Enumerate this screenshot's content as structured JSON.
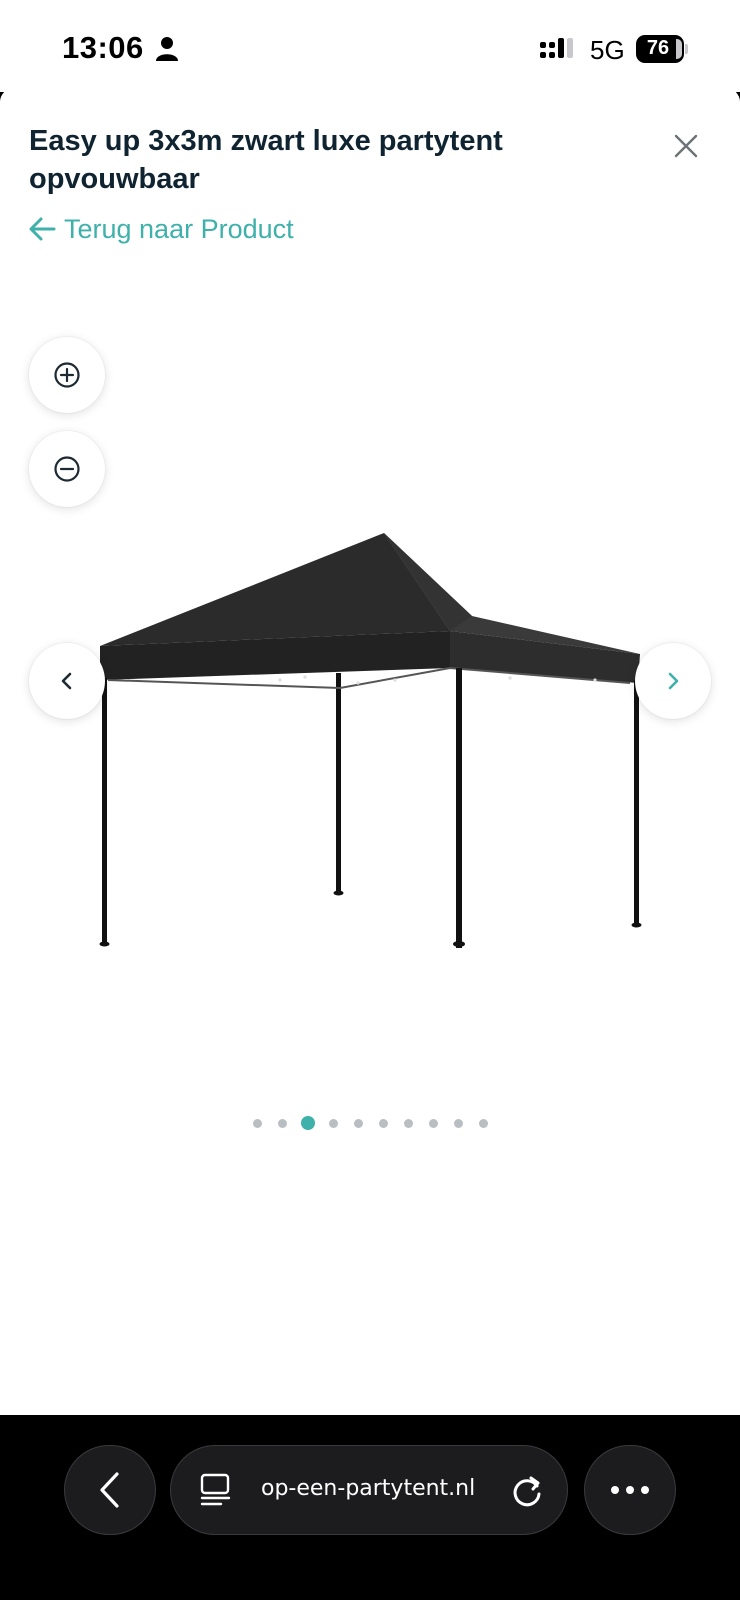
{
  "status_bar": {
    "time": "13:06",
    "network": "5G",
    "battery": "76",
    "icons": [
      "person-icon",
      "signal-icon",
      "battery-icon"
    ]
  },
  "modal": {
    "title": "Easy up 3x3m zwart luxe partytent opvouwbaar",
    "back_link": "Terug naar Product",
    "accent_color": "#3fb1ab",
    "title_color": "#0f2330",
    "gallery": {
      "image": "black pop-up party tent",
      "slide_count": 10,
      "active_slide": 3
    },
    "controls": [
      "zoom-in-icon",
      "zoom-out-icon",
      "chevron-left-icon",
      "chevron-right-icon",
      "close-icon"
    ]
  },
  "browser": {
    "url": "op-een-partytent.nl",
    "icons": [
      "chevron-left-icon",
      "tabs-icon",
      "reload-icon",
      "more-icon"
    ]
  }
}
